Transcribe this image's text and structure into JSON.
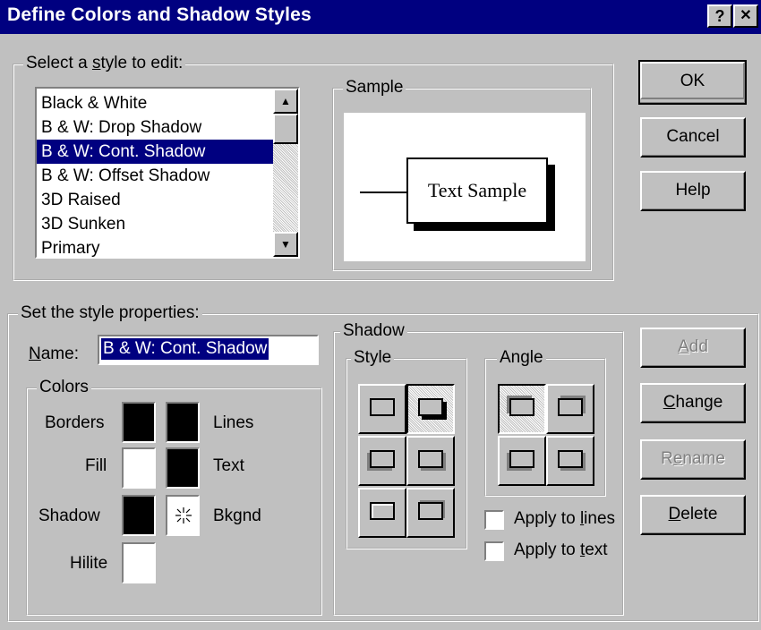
{
  "window": {
    "title": "Define Colors and Shadow Styles",
    "help_glyph": "?",
    "close_glyph": "✕"
  },
  "select_group": {
    "legend_pre": "Select a ",
    "legend_key": "s",
    "legend_post": "tyle to edit:",
    "styles": [
      "Black & White",
      "B & W: Drop Shadow",
      "B & W: Cont. Shadow",
      "B & W: Offset Shadow",
      "3D Raised",
      "3D Sunken",
      "Primary"
    ],
    "selected_index": 2
  },
  "sample": {
    "legend": "Sample",
    "text": "Text Sample"
  },
  "buttons": {
    "ok": "OK",
    "cancel": "Cancel",
    "help": "Help",
    "add_key": "A",
    "add_rest": "dd",
    "change_key": "C",
    "change_rest": "hange",
    "rename_pre": "R",
    "rename_key": "e",
    "rename_post": "name",
    "delete_key": "D",
    "delete_rest": "elete"
  },
  "properties": {
    "legend": "Set the style properties:",
    "name_key": "N",
    "name_rest": "ame:",
    "name_value": "B & W: Cont. Shadow"
  },
  "colors": {
    "legend": "Colors",
    "borders": "Borders",
    "lines": "Lines",
    "fill": "Fill",
    "text": "Text",
    "shadow": "Shadow",
    "bkgnd": "Bkgnd",
    "hilite": "Hilite",
    "swatches": {
      "borders": "#000000",
      "lines": "#000000",
      "fill": "#ffffff",
      "text": "#000000",
      "shadow": "#000000",
      "hilite": "#ffffff"
    }
  },
  "shadow": {
    "legend": "Shadow",
    "style_legend": "Style",
    "angle_legend": "Angle",
    "apply_lines_pre": "Apply to ",
    "apply_lines_key": "l",
    "apply_lines_post": "ines",
    "apply_text_pre": "Apply to ",
    "apply_text_key": "t",
    "apply_text_post": "ext",
    "apply_lines_checked": false,
    "apply_text_checked": false
  }
}
